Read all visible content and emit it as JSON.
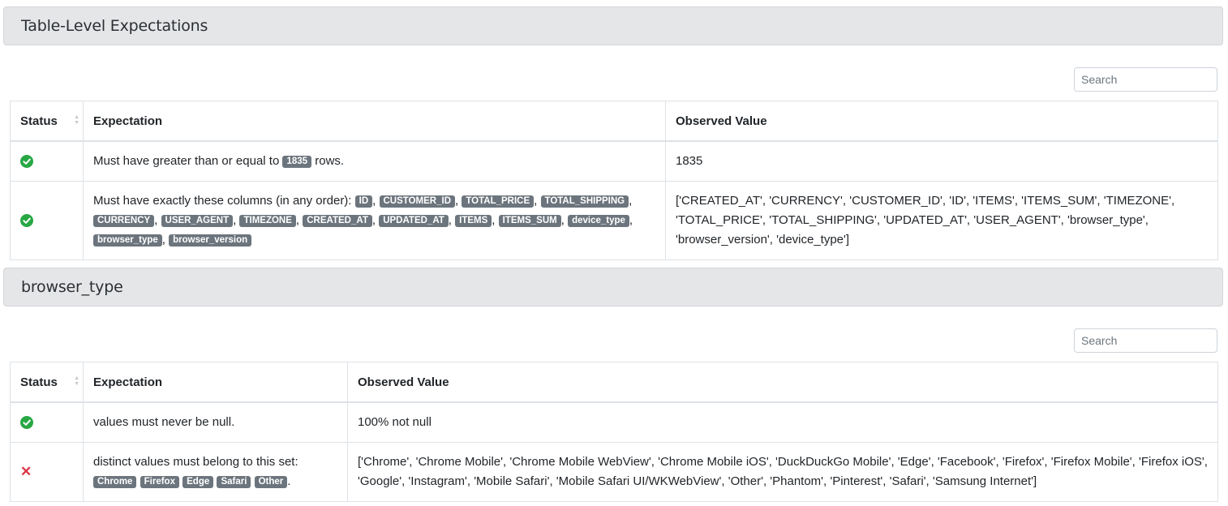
{
  "sections": [
    {
      "title": "Table-Level Expectations",
      "search_placeholder": "Search",
      "headers": {
        "status": "Status",
        "expectation": "Expectation",
        "observed": "Observed Value"
      },
      "rows": [
        {
          "status": "success",
          "expectation_prefix": "Must have greater than or equal to",
          "badges": [
            "1835"
          ],
          "expectation_suffix": "rows.",
          "observed": "1835"
        },
        {
          "status": "success",
          "expectation_prefix": "Must have exactly these columns (in any order):",
          "badges": [
            "ID",
            "CUSTOMER_ID",
            "TOTAL_PRICE",
            "TOTAL_SHIPPING",
            "CURRENCY",
            "USER_AGENT",
            "TIMEZONE",
            "CREATED_AT",
            "UPDATED_AT",
            "ITEMS",
            "ITEMS_SUM",
            "device_type",
            "browser_type",
            "browser_version"
          ],
          "observed": "['CREATED_AT', 'CURRENCY', 'CUSTOMER_ID', 'ID', 'ITEMS', 'ITEMS_SUM', 'TIMEZONE', 'TOTAL_PRICE', 'TOTAL_SHIPPING', 'UPDATED_AT', 'USER_AGENT', 'browser_type', 'browser_version', 'device_type']"
        }
      ]
    },
    {
      "title": "browser_type",
      "search_placeholder": "Search",
      "headers": {
        "status": "Status",
        "expectation": "Expectation",
        "observed": "Observed Value"
      },
      "rows": [
        {
          "status": "success",
          "expectation_prefix": "values must never be null.",
          "observed": "100% not null"
        },
        {
          "status": "failure",
          "expectation_prefix": "distinct values must belong to this set:",
          "badges": [
            "Chrome",
            "Firefox",
            "Edge",
            "Safari",
            "Other"
          ],
          "expectation_suffix": ".",
          "observed": "['Chrome', 'Chrome Mobile', 'Chrome Mobile WebView', 'Chrome Mobile iOS', 'DuckDuckGo Mobile', 'Edge', 'Facebook', 'Firefox', 'Firefox Mobile', 'Firefox iOS', 'Google', 'Instagram', 'Mobile Safari', 'Mobile Safari UI/WKWebView', 'Other', 'Phantom', 'Pinterest', 'Safari', 'Samsung Internet']"
        }
      ]
    }
  ],
  "colors": {
    "success": "#28a745",
    "failure": "#dc3545",
    "badge": "#6c757d",
    "header_bg": "#e5e6e8"
  }
}
